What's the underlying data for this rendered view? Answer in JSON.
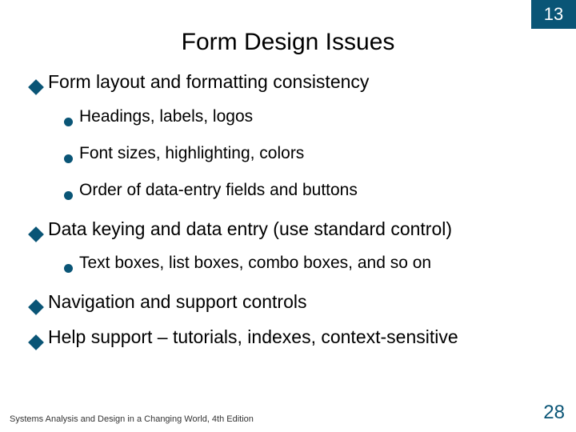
{
  "chapter_number": "13",
  "title": "Form Design Issues",
  "bullets": [
    {
      "text": "Form layout and formatting consistency",
      "sub": [
        "Headings, labels, logos",
        "Font sizes, highlighting, colors",
        "Order of data-entry fields and buttons"
      ]
    },
    {
      "text": "Data keying and data entry (use standard control)",
      "sub": [
        "Text boxes, list boxes, combo boxes, and so on"
      ]
    },
    {
      "text": "Navigation and support controls",
      "sub": []
    },
    {
      "text": "Help support – tutorials, indexes, context-sensitive",
      "sub": []
    }
  ],
  "footer_text": "Systems Analysis and Design in a Changing World, 4th Edition",
  "page_number": "28",
  "colors": {
    "accent": "#0a5576"
  }
}
